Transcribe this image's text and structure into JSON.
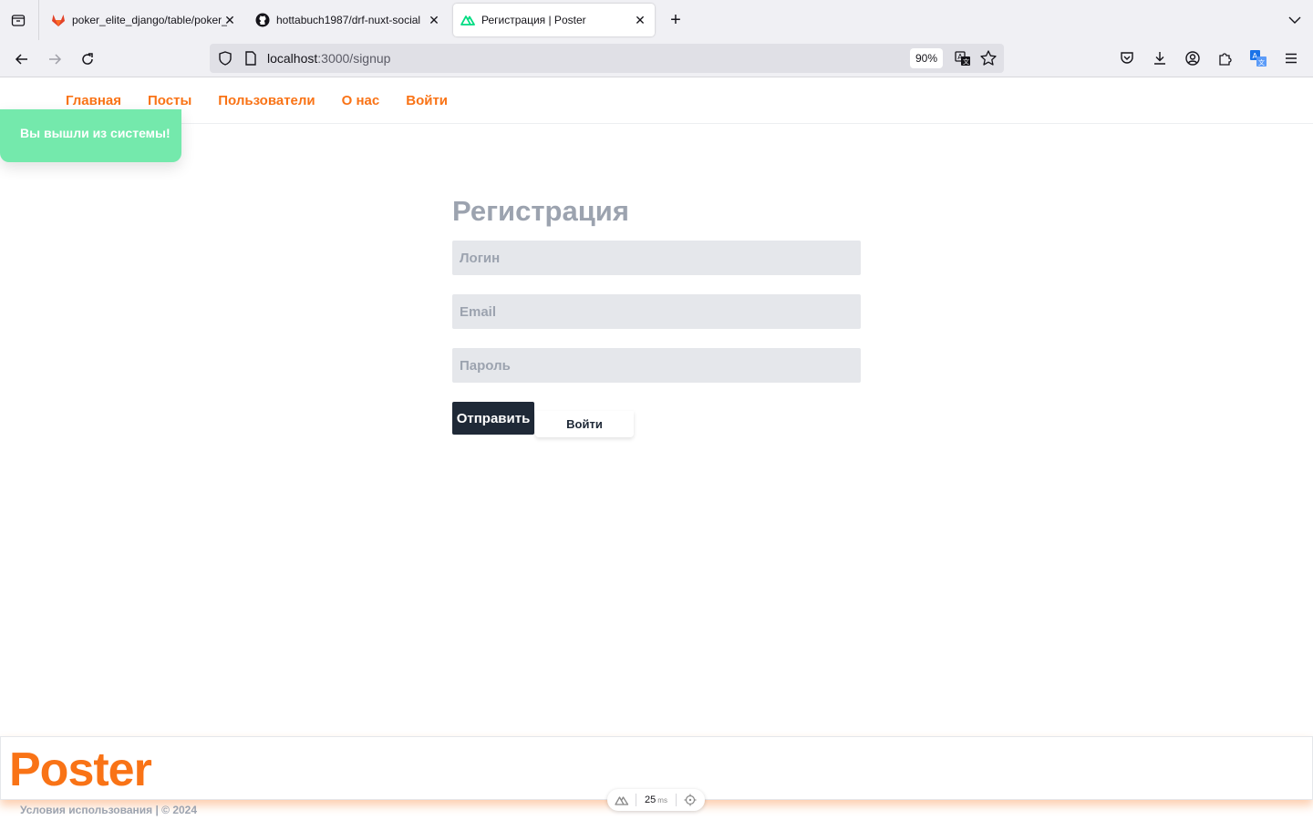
{
  "browser": {
    "tabs": [
      {
        "label": "poker_elite_django/table/poker_",
        "favicon": "gitlab-icon"
      },
      {
        "label": "hottabuch1987/drf-nuxt-social",
        "favicon": "github-icon"
      },
      {
        "label": "Регистрация | Poster",
        "favicon": "nuxt-icon",
        "active": true
      }
    ],
    "url_host": "localhost",
    "url_path": ":3000/signup",
    "zoom": "90%"
  },
  "site": {
    "nav": [
      "Главная",
      "Посты",
      "Пользователи",
      "О нас",
      "Войти"
    ],
    "accent_color": "#f97316"
  },
  "toast": {
    "message": "Вы вышли из системы!",
    "color": "#74e9ac"
  },
  "signup": {
    "title": "Регистрация",
    "login_placeholder": "Логин",
    "email_placeholder": "Email",
    "password_placeholder": "Пароль",
    "submit_label": "Отправить",
    "login_link": "Войти"
  },
  "footer": {
    "logo": "Poster",
    "copyright": "Условия использования | © 2024"
  },
  "devtools": {
    "time_value": "25",
    "time_unit": "ms"
  }
}
